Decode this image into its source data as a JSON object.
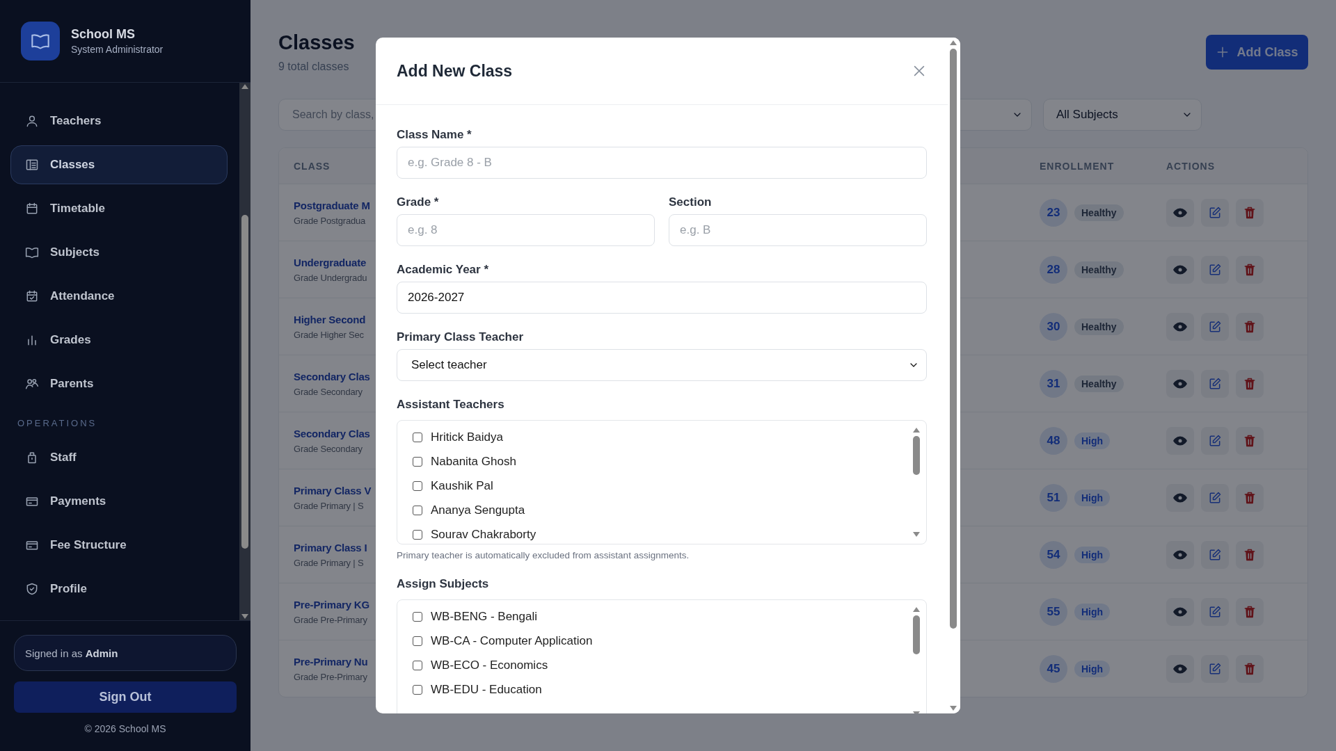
{
  "sidebar": {
    "brand": "School MS",
    "role": "System Administrator",
    "nav_groups": [
      {
        "items": [
          {
            "label": "Teachers",
            "selected": false
          },
          {
            "label": "Classes",
            "selected": true
          },
          {
            "label": "Timetable",
            "selected": false
          },
          {
            "label": "Subjects",
            "selected": false
          },
          {
            "label": "Attendance",
            "selected": false
          },
          {
            "label": "Grades",
            "selected": false
          },
          {
            "label": "Parents",
            "selected": false
          }
        ]
      },
      {
        "heading": "OPERATIONS",
        "items": [
          {
            "label": "Staff",
            "selected": false
          },
          {
            "label": "Payments",
            "selected": false
          },
          {
            "label": "Fee Structure",
            "selected": false
          },
          {
            "label": "Profile",
            "selected": false
          }
        ]
      }
    ],
    "signed_in": "Signed in as **Admin**",
    "sign_out": "Sign Out",
    "copyright": "© 2026 School MS"
  },
  "page": {
    "title": "Classes",
    "subtitle": "9 total classes",
    "add_button": "Add Class",
    "search": {
      "placeholder": "Search by class,"
    },
    "subject_filter": "All Subjects",
    "table": {
      "columns": [
        "CLASS",
        "ENROLLMENT",
        "ACTIONS"
      ],
      "rows": [
        {
          "name": "Postgraduate M",
          "detail": "Grade Postgradua",
          "count": "23",
          "status": "Healthy",
          "kind": "healthy"
        },
        {
          "name": "Undergraduate",
          "detail": "Grade Undergradu",
          "count": "28",
          "status": "Healthy",
          "kind": "healthy"
        },
        {
          "name": "Higher Second",
          "detail": "Grade Higher Sec",
          "count": "30",
          "status": "Healthy",
          "kind": "healthy"
        },
        {
          "name": "Secondary Clas",
          "detail": "Grade Secondary",
          "count": "31",
          "status": "Healthy",
          "kind": "healthy"
        },
        {
          "name": "Secondary Clas",
          "detail": "Grade Secondary",
          "count": "48",
          "status": "High",
          "kind": "high"
        },
        {
          "name": "Primary Class V",
          "detail": "Grade Primary | S",
          "count": "51",
          "status": "High",
          "kind": "high"
        },
        {
          "name": "Primary Class I",
          "detail": "Grade Primary | S",
          "count": "54",
          "status": "High",
          "kind": "high"
        },
        {
          "name": "Pre-Primary KG",
          "detail": "Grade Pre-Primary",
          "count": "55",
          "status": "High",
          "kind": "high"
        },
        {
          "name": "Pre-Primary Nu",
          "detail": "Grade Pre-Primary",
          "count": "45",
          "status": "High",
          "kind": "high"
        }
      ]
    }
  },
  "modal": {
    "title": "Add New Class",
    "class_name": {
      "label": "Class Name *",
      "placeholder": "e.g. Grade 8 - B"
    },
    "grade": {
      "label": "Grade *",
      "placeholder": "e.g. 8"
    },
    "section": {
      "label": "Section",
      "placeholder": "e.g. B"
    },
    "academic_year": {
      "label": "Academic Year *",
      "value": "2026-2027"
    },
    "primary_teacher": {
      "label": "Primary Class Teacher",
      "value": "Select teacher"
    },
    "assistant_teachers": {
      "label": "Assistant Teachers",
      "hint": "Primary teacher is automatically excluded from assistant assignments.",
      "options": [
        {
          "label": "Hritick Baidya",
          "checked": false
        },
        {
          "label": "Nabanita Ghosh",
          "checked": false
        },
        {
          "label": "Kaushik Pal",
          "checked": false
        },
        {
          "label": "Ananya Sengupta",
          "checked": false
        },
        {
          "label": "Sourav Chakraborty",
          "checked": false
        }
      ]
    },
    "subjects": {
      "label": "Assign Subjects",
      "options": [
        {
          "label": "WB-BENG - Bengali",
          "checked": false
        },
        {
          "label": "WB-CA - Computer Application",
          "checked": false
        },
        {
          "label": "WB-ECO - Economics",
          "checked": false
        },
        {
          "label": "WB-EDU - Education",
          "checked": false
        }
      ]
    }
  }
}
